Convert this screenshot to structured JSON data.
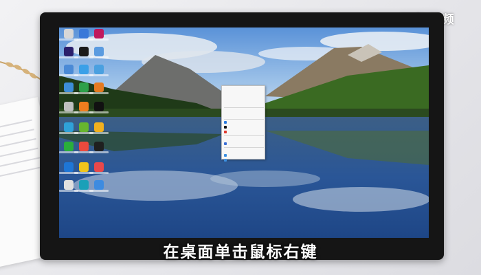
{
  "watermark": "天奇·视频",
  "caption": "在桌面单击鼠标右键",
  "desktop_icons": [
    {
      "name": "recycle-bin-icon",
      "color": "#d7d7d7"
    },
    {
      "name": "maxthon-browser-icon",
      "color": "#3a78d8"
    },
    {
      "name": "app-icon",
      "color": "#c0185d"
    },
    {
      "name": "premiere-icon",
      "color": "#2a1f6b"
    },
    {
      "name": "qq-icon",
      "color": "#1a1a1a"
    },
    {
      "name": "network-icon",
      "color": "#5a9be0"
    },
    {
      "name": "settings-icon",
      "color": "#4a8ad6"
    },
    {
      "name": "app-icon",
      "color": "#3aa0e8"
    },
    {
      "name": "app-icon",
      "color": "#4aa0e0"
    },
    {
      "name": "app-icon",
      "color": "#3d8ed8"
    },
    {
      "name": "media-player-icon",
      "color": "#2ea04a"
    },
    {
      "name": "app-icon",
      "color": "#e57a20"
    },
    {
      "name": "recycle-icon",
      "color": "#bfbfbf"
    },
    {
      "name": "tool-icon",
      "color": "#ef7d1e"
    },
    {
      "name": "tiktok-icon",
      "color": "#111111"
    },
    {
      "name": "app-icon",
      "color": "#2fa2d9"
    },
    {
      "name": "app-icon",
      "color": "#67b62e"
    },
    {
      "name": "app-icon",
      "color": "#f2b01e"
    },
    {
      "name": "wechat-icon",
      "color": "#2aae3b"
    },
    {
      "name": "app-icon",
      "color": "#e94a3d"
    },
    {
      "name": "app-icon",
      "color": "#1f1f1f"
    },
    {
      "name": "shield-icon",
      "color": "#1e76d6"
    },
    {
      "name": "app-icon",
      "color": "#f0c51c"
    },
    {
      "name": "app-icon",
      "color": "#e8484a"
    },
    {
      "name": "pen-icon",
      "color": "#e0e0e0"
    },
    {
      "name": "edge-icon",
      "color": "#1aa0b8"
    },
    {
      "name": "app-icon",
      "color": "#3d8be0"
    }
  ],
  "context_menu": {
    "items": [
      {
        "label": "",
        "icon": "",
        "arrow": "",
        "disabled": false
      },
      {
        "label": "",
        "icon": "",
        "arrow": "",
        "disabled": false
      },
      {
        "label": "",
        "icon": "",
        "arrow": "",
        "disabled": false
      },
      {
        "label": "",
        "icon": "",
        "arrow": "",
        "disabled": false
      },
      {
        "label": "",
        "icon": "",
        "arrow": "",
        "disabled": true
      },
      {
        "label": "",
        "icon": "",
        "arrow": "",
        "disabled": true
      },
      {
        "label": "",
        "icon": "#2a7ae0",
        "arrow": "",
        "disabled": false
      },
      {
        "label": "",
        "icon": "#111111",
        "arrow": "",
        "disabled": false
      },
      {
        "label": "",
        "icon": "#e0392e",
        "arrow": "",
        "disabled": false
      },
      {
        "label": "",
        "icon": "",
        "arrow": "",
        "disabled": false
      },
      {
        "label": "",
        "icon": "#3b6fd6",
        "arrow": "",
        "disabled": false
      },
      {
        "label": "",
        "icon": "",
        "arrow": "",
        "disabled": false
      },
      {
        "label": "",
        "icon": "#3b8fe0",
        "arrow": "",
        "disabled": false
      },
      {
        "label": "",
        "icon": "#3b8fe0",
        "arrow": "",
        "disabled": false
      }
    ]
  },
  "colors": {
    "sky": "#6fa3de",
    "mountain": "#6b6f6f",
    "forest": "#2c4a1e",
    "lake": "#294f8a",
    "caption_text": "#ffffff"
  }
}
